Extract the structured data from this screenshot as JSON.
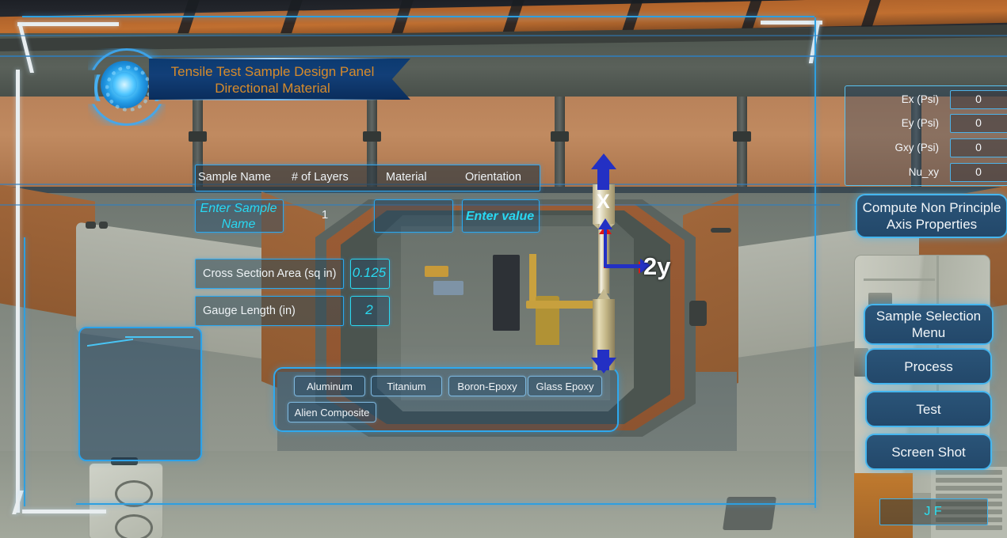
{
  "app": {
    "title_line1": "Tensile Test Sample Design Panel",
    "title_line2": "Directional Material",
    "emblem_icon": "hud-reactor-icon"
  },
  "table": {
    "headers": [
      "Sample Name",
      "# of Layers",
      "Material",
      "Orientation"
    ],
    "row": {
      "sample_name_value": "",
      "sample_name_placeholder": "Enter Sample Name",
      "layers_value": "1",
      "material_value": "",
      "orientation_value": "",
      "orientation_placeholder": "Enter value"
    }
  },
  "geometry": {
    "cross_section_label": "Cross Section Area (sq in)",
    "cross_section_value": "0.125",
    "gauge_length_label": "Gauge Length (in)",
    "gauge_length_value": "2"
  },
  "materials": {
    "buttons": [
      "Aluminum",
      "Titanium",
      "Boron-Epoxy",
      "Glass Epoxy",
      "Alien Composite"
    ]
  },
  "properties": {
    "rows": [
      {
        "label": "Ex (Psi)",
        "value": "0"
      },
      {
        "label": "Ey (Psi)",
        "value": "0"
      },
      {
        "label": "Gxy (Psi)",
        "value": "0"
      },
      {
        "label": "Nu_xy",
        "value": "0"
      }
    ]
  },
  "actions": {
    "compute": "Compute Non Principle Axis Properties",
    "sample_selection": "Sample Selection Menu",
    "process": "Process",
    "test": "Test",
    "screen_shot": "Screen Shot"
  },
  "status": {
    "jf_label": "J F"
  },
  "viewport": {
    "specimen_label_x": "X",
    "axis_label_y": "2y",
    "specimen_icon": "tensile-dogbone-specimen",
    "load_arrow_icon": "tension-load-arrow"
  },
  "colors": {
    "hud_cyan": "#29a8f0",
    "hud_cyan_bright": "#2ae0f2",
    "title_orange": "#d78b2b",
    "button_blue": "#2a5478",
    "arrow_blue": "#2330c4",
    "arrow_red": "#e01515"
  }
}
